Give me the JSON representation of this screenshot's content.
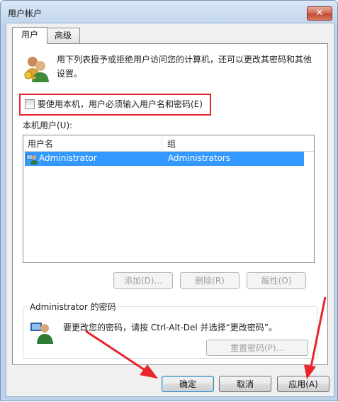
{
  "window": {
    "title": "用户帐户",
    "close_glyph": "✕"
  },
  "tabs": [
    {
      "label": "用户",
      "active": true
    },
    {
      "label": "高级",
      "active": false
    }
  ],
  "description": "用下列表授予或拒绝用户访问您的计算机，还可以更改其密码和其他设置。",
  "require_password": {
    "label": "要使用本机，用户必须输入用户名和密码(E)",
    "checked": false
  },
  "users_section": {
    "label": "本机用户(U):",
    "columns": [
      "用户名",
      "组"
    ],
    "rows": [
      {
        "username": "Administrator",
        "group": "Administrators",
        "selected": true,
        "icon": "user-account-icon"
      }
    ]
  },
  "list_buttons": {
    "add": "添加(D)...",
    "remove": "删除(R)",
    "properties": "属性(O)"
  },
  "password_section": {
    "title": "Administrator 的密码",
    "text": "要更改您的密码，请按 Ctrl-Alt-Del 并选择“更改密码”。",
    "reset_button": "重置密码(P)...",
    "icon": "user-key-icon"
  },
  "dialog_buttons": {
    "ok": "确定",
    "cancel": "取消",
    "apply": "应用(A)"
  },
  "colors": {
    "highlight_box": "#e8252b",
    "selection": "#3399ff",
    "annotation_arrow": "#e8252b"
  }
}
